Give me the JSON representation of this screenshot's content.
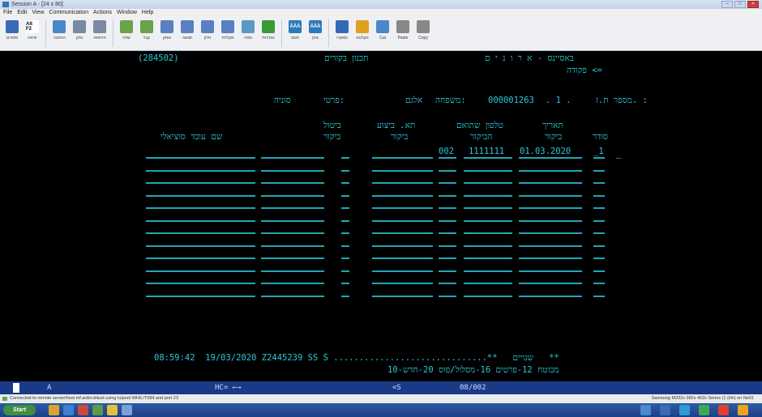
{
  "window": {
    "title": "Session A - [24 x 80]"
  },
  "menubar": [
    "File",
    "Edit",
    "View",
    "Communication",
    "Actions",
    "Window",
    "Help"
  ],
  "toolbar": [
    {
      "icon": "monitor-icon",
      "label": "מסכים",
      "color": "#3a6ab5"
    },
    {
      "icon": "alt-f2-key-icon",
      "label": "יציאה",
      "glyph": "Alt F2",
      "color": "#ffffff"
    },
    {
      "icon": "connect-icon",
      "label": "התחבר",
      "color": "#4a87c9"
    },
    {
      "icon": "disconnect-icon",
      "label": "נתק",
      "color": "#7a8aa0"
    },
    {
      "icon": "print-icon",
      "label": "הדפסה",
      "color": "#7a8aa0"
    },
    {
      "icon": "transfer-send-icon",
      "label": "שלח",
      "color": "#6aa24a"
    },
    {
      "icon": "transfer-receive-icon",
      "label": "קבל",
      "color": "#6aa24a"
    },
    {
      "icon": "clipboard-icon",
      "label": "עותק",
      "color": "#5a7fc2"
    },
    {
      "icon": "screen-icon",
      "label": "תצוגה",
      "color": "#5a7fc2"
    },
    {
      "icon": "window-icon",
      "label": "חלון",
      "color": "#5a7fc2"
    },
    {
      "icon": "keyboard-icon",
      "label": "מקלדת",
      "color": "#5a7fc2"
    },
    {
      "icon": "map-icon",
      "label": "מפה",
      "color": "#5a9ac2"
    },
    {
      "icon": "settings-icon",
      "label": "הגדרות",
      "color": "#3a9a3a"
    },
    {
      "icon": "aaa-icon",
      "label": "פונט",
      "glyph": "ÄÄÄ",
      "color": "#2c7ab8"
    },
    {
      "icon": "aaa-bold-icon",
      "label": "גופן",
      "glyph": "ÄÄÄ",
      "color": "#2c7ab8"
    },
    {
      "icon": "macro-icon",
      "label": "מאקרו",
      "color": "#3569b8"
    },
    {
      "icon": "macro-record-icon",
      "label": "הקלטה",
      "color": "#e0a020"
    },
    {
      "icon": "cut-icon",
      "label": "Cut",
      "color": "#4a87c9"
    },
    {
      "icon": "paste-icon",
      "label": "Paste",
      "color": "#888888"
    },
    {
      "icon": "copy-icon",
      "label": "Copy",
      "color": "#888888"
    }
  ],
  "screen": {
    "session_id": "(284502)",
    "app_name": "באסיינס - א ר ו נ י ם",
    "screen_title": "תכנון בקורים",
    "command_label": "פקודה <=",
    "id_label": "מספר ת.ז. :",
    "id_prefix": ". 1 .",
    "id_value": "000001263",
    "family_label": "משפחה:",
    "family_value": "אלגם",
    "first_name_label": "פרטי:",
    "first_name_value": "סוניה",
    "columns": {
      "serial": "סודר",
      "visit_date_1": "תאריך",
      "visit_date_2": "ביקור",
      "phone_1": "טלפון שתואם",
      "phone_2": "הביקור",
      "execution_date_1": "תא. ביצוע",
      "execution_date_2": "ביקור",
      "cancel_1": "ביטול",
      "cancel_2": "ביקור",
      "social_worker": "שם עובד סוציאלי"
    },
    "row1": {
      "serial": "_1",
      "visit_date": "01.03.2020",
      "phone": "1111111",
      "code": "002"
    },
    "footer_line": "08:59:42  19/03/2020 Z2445239 SS S ..............................**   שנויים   **",
    "function_keys": "10-מבוטח 12-פרטים 16-מסלול/פוס 20-חדש",
    "status": {
      "indicator": "A",
      "hc": "HC= ←→",
      "cs": "<S",
      "position": "08/002"
    }
  },
  "infobar": {
    "left": "Connected to remote server/host mf.ardm.bituot using lu/pool WHIL/T084 and port 23",
    "right": "Samsung M332x 382x 402x Series (1 (Hh) on Ne01"
  },
  "taskbar": {
    "start_label": "Start"
  },
  "colors": {
    "screen_bg": "#000000",
    "field_color": "#2ec7d6",
    "input_color": "#6fe06f",
    "status_bg": "#1a3a88"
  }
}
